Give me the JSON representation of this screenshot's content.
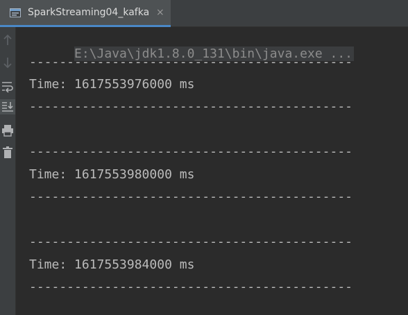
{
  "tab": {
    "title": "SparkStreaming04_kafka",
    "close_glyph": "×"
  },
  "gutter": {
    "icons": [
      "up-arrow-icon",
      "down-arrow-icon",
      "soft-wrap-icon",
      "scroll-to-end-icon",
      "print-icon",
      "trash-icon"
    ]
  },
  "console": {
    "command": "E:\\Java\\jdk1.8.0_131\\bin\\java.exe ...",
    "separator": "-------------------------------------------",
    "batches": [
      {
        "time": "Time: 1617553976000 ms"
      },
      {
        "time": "Time: 1617553980000 ms"
      },
      {
        "time": "Time: 1617553984000 ms"
      }
    ]
  },
  "colors": {
    "background": "#2b2b2b",
    "tab_accent": "#4a88c7",
    "text": "#bbbbbb",
    "command_text": "#8c8c8c"
  }
}
